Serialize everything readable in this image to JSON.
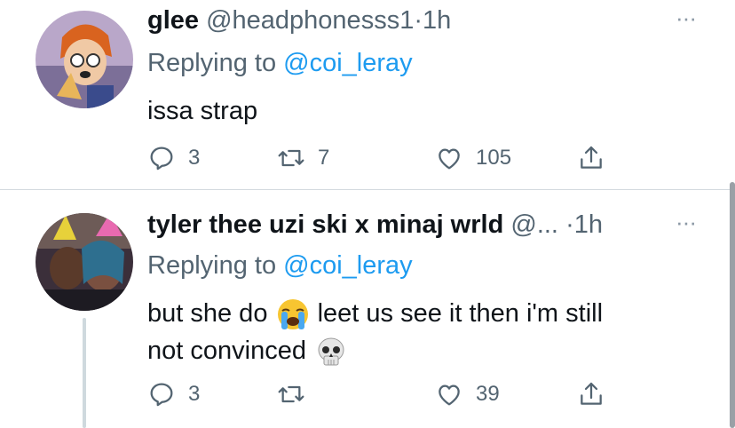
{
  "tweets": [
    {
      "display_name": "glee",
      "handle": "@headphonesss1",
      "separator": "·",
      "time": "1h",
      "more": "···",
      "replying_prefix": "Replying to ",
      "replying_to": "@coi_leray",
      "text_1": "issa strap",
      "text_2": "",
      "counts": {
        "replies": "3",
        "retweets": "7",
        "likes": "105"
      }
    },
    {
      "display_name": "tyler thee uzi ski x minaj wrld",
      "handle": "@...",
      "separator": "·",
      "time": "1h",
      "more": "···",
      "replying_prefix": "Replying to ",
      "replying_to": "@coi_leray",
      "text_1": "but she do",
      "text_2": "leet us see it then i'm still",
      "text_3": "not convinced",
      "counts": {
        "replies": "3",
        "retweets": "",
        "likes": "39"
      }
    }
  ],
  "icons": {
    "reply": "speech-bubble-icon",
    "retweet": "retweet-arrows-icon",
    "like": "heart-outline-icon",
    "share": "share-upload-icon",
    "emoji_1": "loudly-crying-face-emoji",
    "emoji_2": "skull-emoji"
  },
  "colors": {
    "accent": "#1d9bf0",
    "secondary_text": "#536471",
    "primary_text": "#0f1419"
  }
}
